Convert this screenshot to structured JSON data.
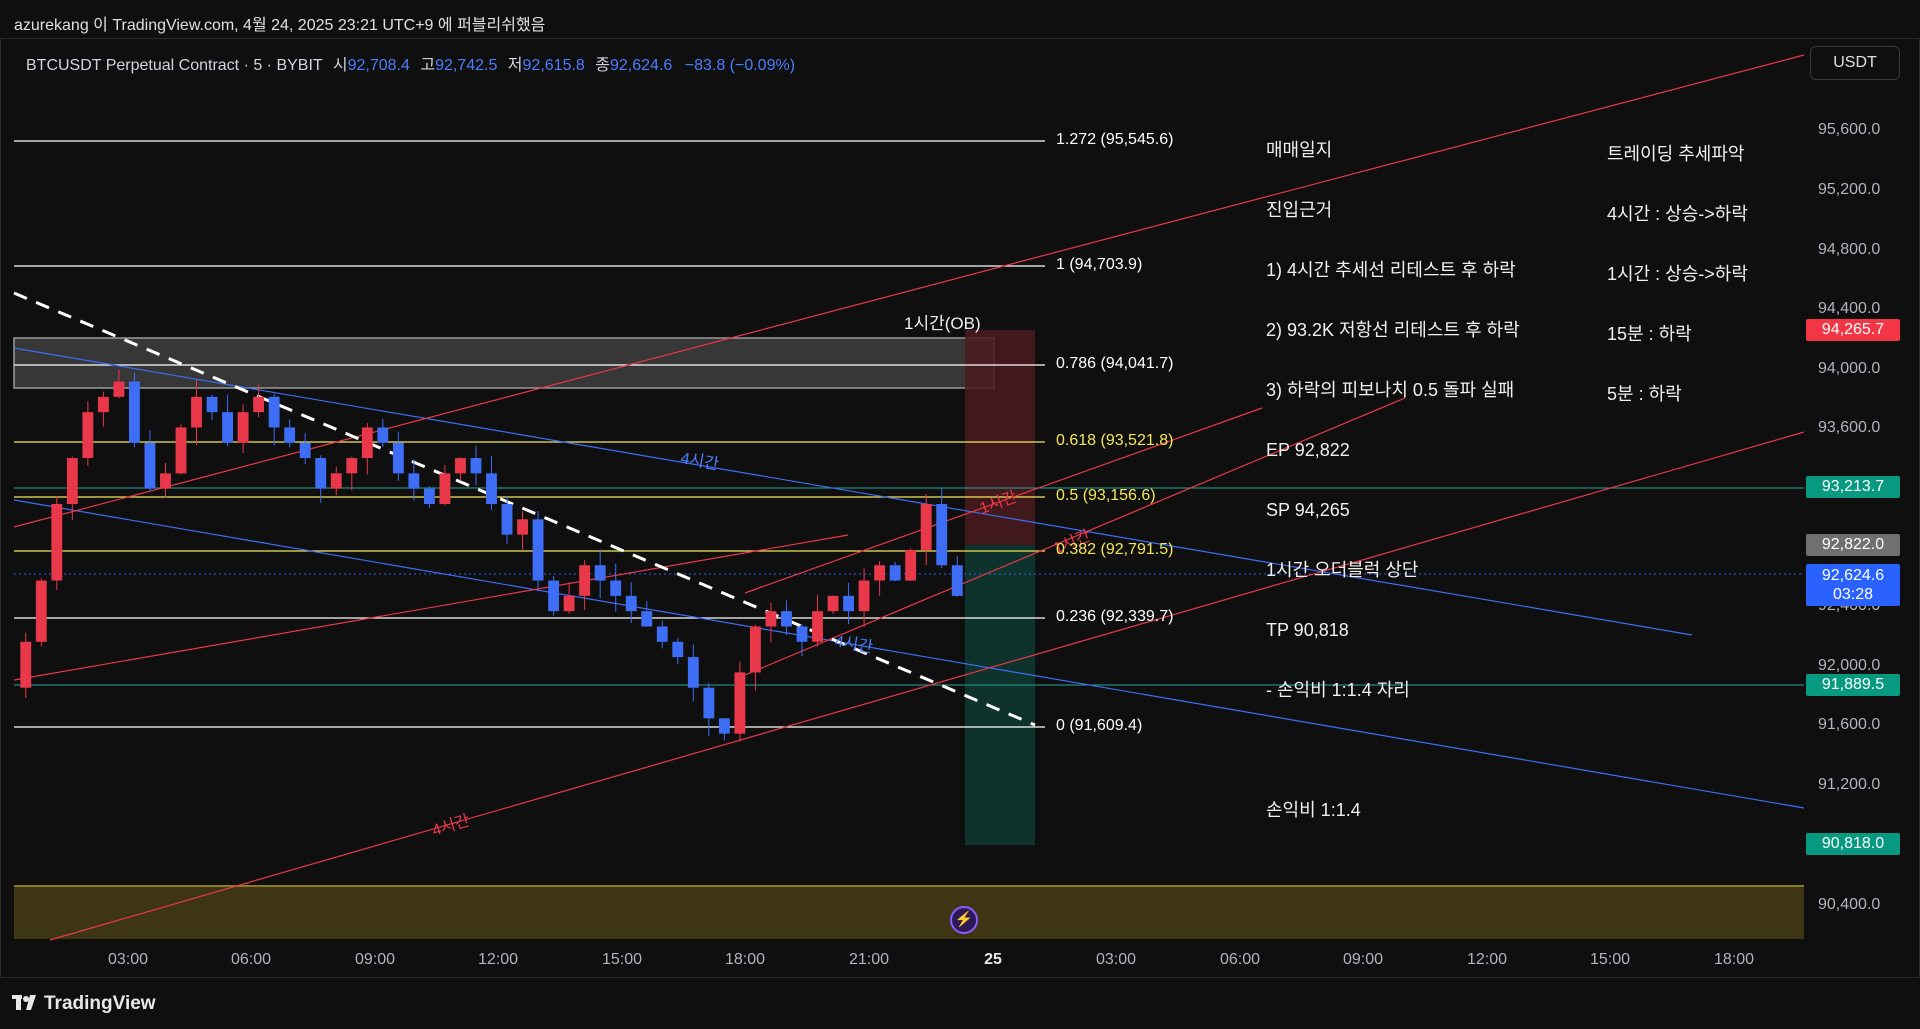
{
  "header": {
    "published": "azurekang 이 TradingView.com, 4월 24, 2025 23:21 UTC+9 에 퍼블리쉬했음"
  },
  "legend": {
    "symbol": "BTCUSDT Perpetual Contract · 5 · BYBIT",
    "open_label": "시",
    "open": "92,708.4",
    "high_label": "고",
    "high": "92,742.5",
    "low_label": "저",
    "low": "92,615.8",
    "close_label": "종",
    "close": "92,624.6",
    "change": "−83.8 (−0.09%)"
  },
  "currency": "USDT",
  "footer": {
    "brand": "TradingView",
    "logo": "tradingview-logo-icon"
  },
  "colors": {
    "bull": "#e8384a",
    "bear": "#3d6ef5",
    "trend4h_red": "#e8384a",
    "trend4h_blue": "#3d6ef5",
    "fib_white": "#ffffff",
    "fib_yellow": "#f2e85a",
    "teal": "#26a69a",
    "ob_box": "#5a5a5a",
    "tp_zone": "#0e3a33",
    "sl_zone": "#4a1a1e",
    "bottom_band": "#3d3514"
  },
  "notes": {
    "journal": [
      "매매일지",
      "진입근거",
      "1) 4시간 추세선 리테스트 후 하락",
      "2) 93.2K 저항선 리테스트 후 하락",
      "3) 하락의 피보나치 0.5 돌파 실패",
      "EP 92,822",
      "SP 94,265",
      "1시간 오더블럭 상단",
      "TP 90,818",
      "- 손익비 1:1.4 자리",
      "",
      "손익비 1:1.4"
    ],
    "trend": [
      "트레이딩 추세파악",
      "4시간 : 상승->하락",
      "1시간 : 상승->하락",
      "15분 : 하락",
      "5분 : 하락"
    ]
  },
  "annotations": {
    "ob": "1시간(OB)",
    "ch4_blue_a": "4시간",
    "ch4_blue_b": "4시간",
    "ch1_a": "1시간",
    "ch1_b": "1시간",
    "ch4_red": "4시간"
  },
  "badge": "flash-icon",
  "chart_data": {
    "type": "candlestick",
    "title": "BTCUSDT Perpetual Contract · 5 · BYBIT",
    "y_axis": {
      "ticks": [
        "95,600.0",
        "95,200.0",
        "94,800.0",
        "94,400.0",
        "94,000.0",
        "93,600.0",
        "92,400.0",
        "92,000.0",
        "91,600.0",
        "91,200.0",
        "90,400.0"
      ],
      "range": [
        90300,
        96100
      ]
    },
    "x_axis": {
      "ticks": [
        "03:00",
        "06:00",
        "09:00",
        "12:00",
        "15:00",
        "18:00",
        "21:00",
        "25",
        "03:00",
        "06:00",
        "09:00",
        "12:00",
        "15:00",
        "18:00"
      ]
    },
    "price_tags": [
      {
        "value": "94,265.7",
        "color": "#f23645"
      },
      {
        "value": "93,213.7",
        "color": "#089981"
      },
      {
        "value": "92,822.0",
        "color": "#707070"
      },
      {
        "value": "92,624.6",
        "sub": "03:28",
        "color": "#2962ff"
      },
      {
        "value": "91,889.5",
        "color": "#089981"
      },
      {
        "value": "90,818.0",
        "color": "#089981"
      }
    ],
    "fibonacci": [
      {
        "label": "1.272 (95,545.6)",
        "price": 95545.6,
        "color": "#ffffff"
      },
      {
        "label": "1 (94,703.9)",
        "price": 94703.9,
        "color": "#ffffff"
      },
      {
        "label": "0.786 (94,041.7)",
        "price": 94041.7,
        "color": "#ffffff"
      },
      {
        "label": "0.618 (93,521.8)",
        "price": 93521.8,
        "color": "#f2e85a"
      },
      {
        "label": "0.5 (93,156.6)",
        "price": 93156.6,
        "color": "#f2e85a"
      },
      {
        "label": "0.382 (92,791.5)",
        "price": 92791.5,
        "color": "#f2e85a"
      },
      {
        "label": "0.236 (92,339.7)",
        "price": 92339.7,
        "color": "#ffffff"
      },
      {
        "label": "0 (91,609.4)",
        "price": 91609.4,
        "color": "#ffffff"
      }
    ],
    "position": {
      "entry": 92822,
      "stop": 94265,
      "target": 90818
    },
    "candles_close": [
      92300,
      92700,
      93200,
      93500,
      93800,
      93900,
      94000,
      93600,
      93300,
      93400,
      93700,
      93900,
      93800,
      93600,
      93800,
      93900,
      93700,
      93600,
      93500,
      93300,
      93400,
      93500,
      93700,
      93600,
      93400,
      93300,
      93200,
      93400,
      93500,
      93400,
      93200,
      93000,
      93100,
      92700,
      92500,
      92600,
      92800,
      92700,
      92600,
      92500,
      92400,
      92300,
      92200,
      92000,
      91800,
      91700,
      92100,
      92400,
      92500,
      92400,
      92300,
      92500,
      92600,
      92500,
      92700,
      92800,
      92700,
      92900,
      93200,
      92800,
      92600
    ]
  }
}
